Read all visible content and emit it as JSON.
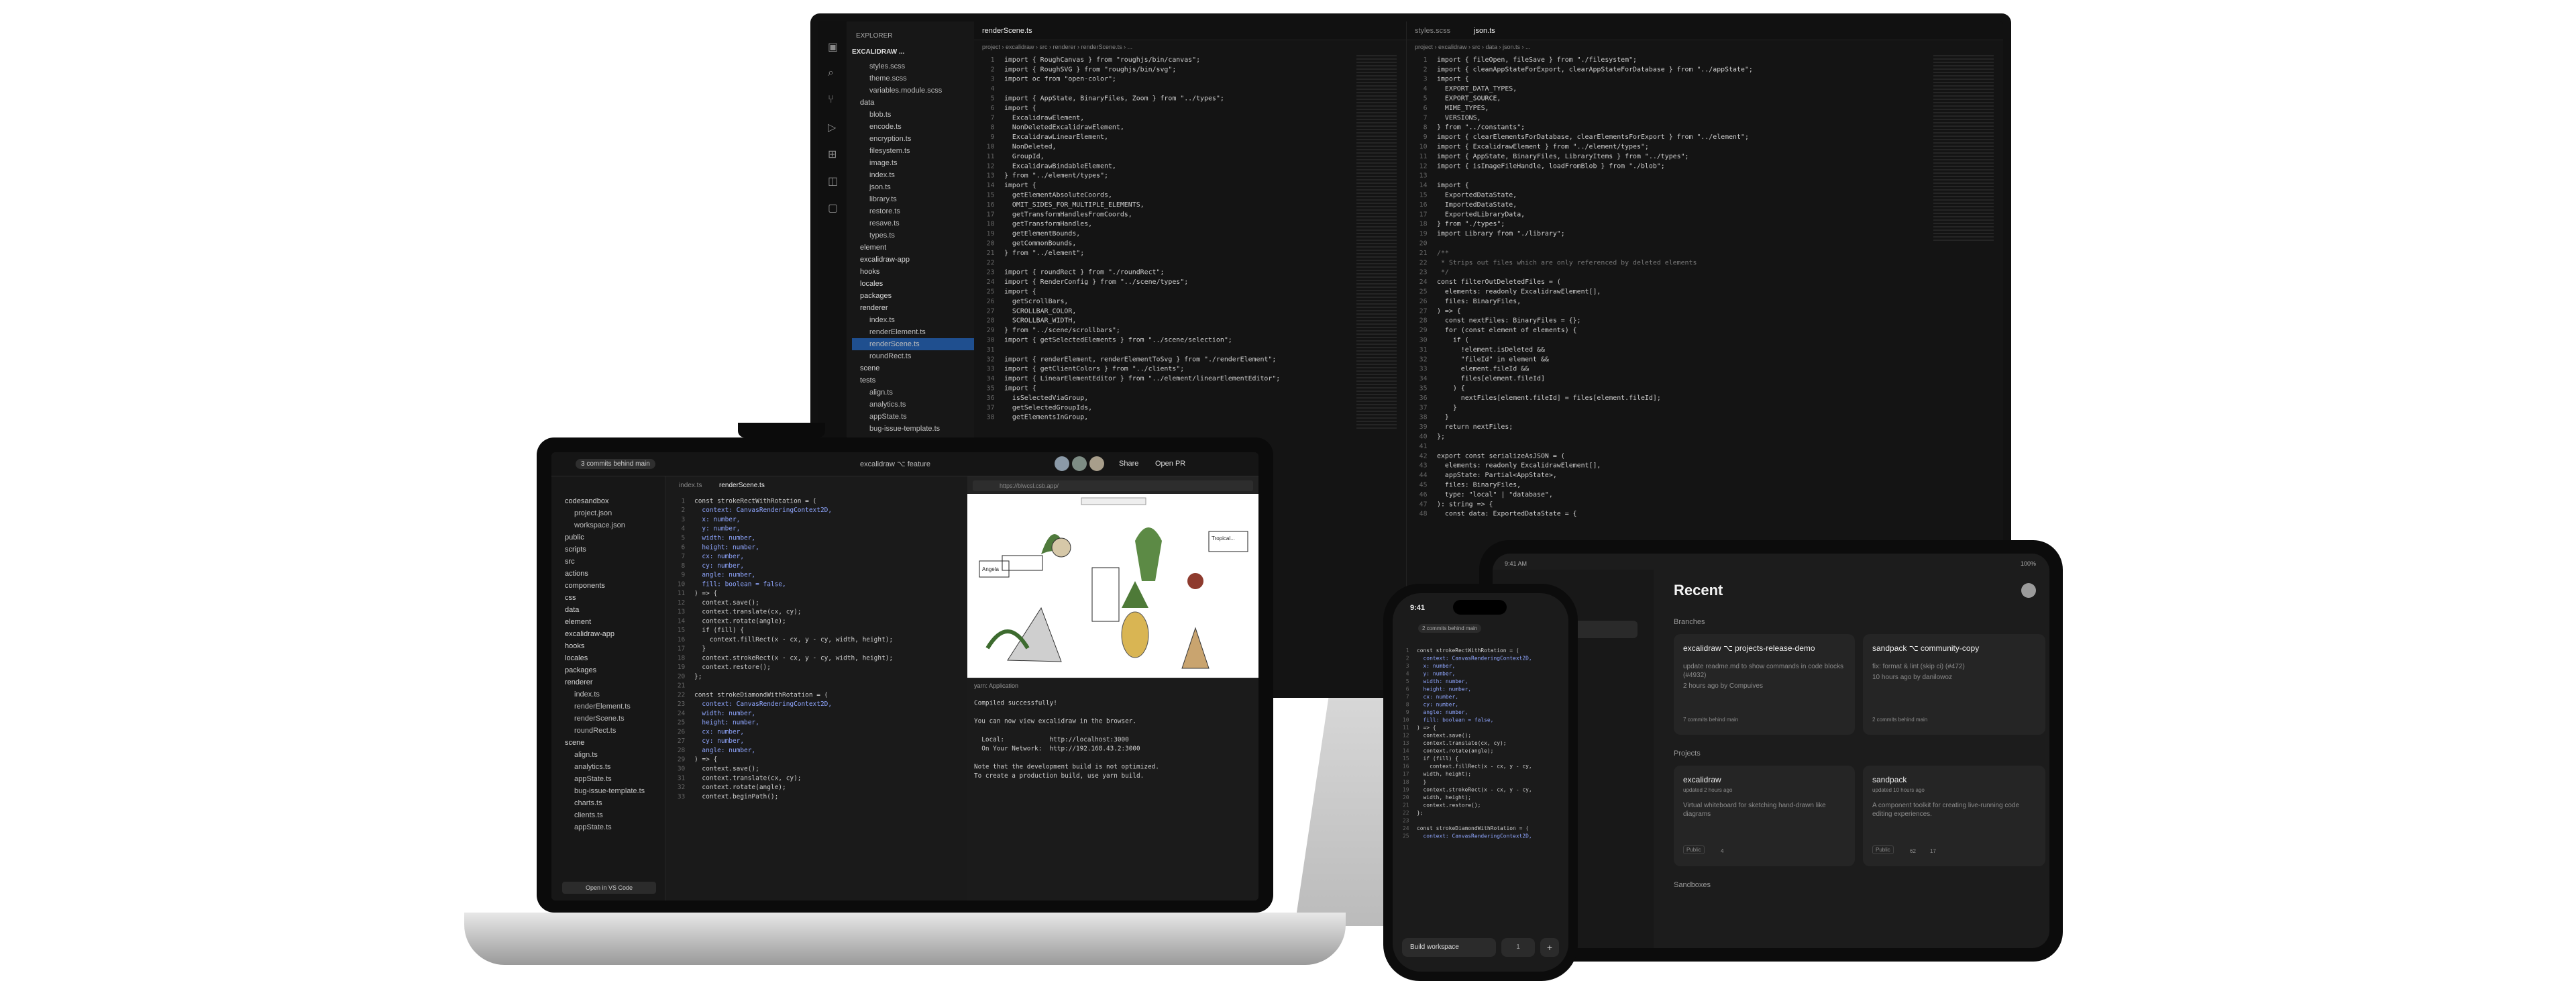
{
  "monitor": {
    "explorer_title": "EXPLORER",
    "project": "EXCALIDRAW ...",
    "tree": [
      "styles.scss",
      "theme.scss",
      "variables.module.scss",
      "data",
      "blob.ts",
      "encode.ts",
      "encryption.ts",
      "filesystem.ts",
      "image.ts",
      "index.ts",
      "json.ts",
      "library.ts",
      "restore.ts",
      "resave.ts",
      "types.ts",
      "element",
      "excalidraw-app",
      "hooks",
      "locales",
      "packages",
      "renderer",
      "index.ts",
      "renderElement.ts",
      "renderScene.ts",
      "roundRect.ts",
      "scene",
      "tests",
      "align.ts",
      "analytics.ts",
      "appState.ts",
      "bug-issue-template.ts"
    ],
    "tab_left": "renderScene.ts",
    "breadcrumb_left": "project › excalidraw › src › renderer › renderScene.ts › ...",
    "tab_right_1": "styles.scss",
    "tab_right_2": "json.ts",
    "breadcrumb_right": "project › excalidraw › src › data › json.ts › ...",
    "code_left": [
      "import { RoughCanvas } from \"roughjs/bin/canvas\";",
      "import { RoughSVG } from \"roughjs/bin/svg\";",
      "import oc from \"open-color\";",
      "",
      "import { AppState, BinaryFiles, Zoom } from \"../types\";",
      "import {",
      "  ExcalidrawElement,",
      "  NonDeletedExcalidrawElement,",
      "  ExcalidrawLinearElement,",
      "  NonDeleted,",
      "  GroupId,",
      "  ExcalidrawBindableElement,",
      "} from \"../element/types\";",
      "import {",
      "  getElementAbsoluteCoords,",
      "  OMIT_SIDES_FOR_MULTIPLE_ELEMENTS,",
      "  getTransformHandlesFromCoords,",
      "  getTransformHandles,",
      "  getElementBounds,",
      "  getCommonBounds,",
      "} from \"../element\";",
      "",
      "import { roundRect } from \"./roundRect\";",
      "import { RenderConfig } from \"../scene/types\";",
      "import {",
      "  getScrollBars,",
      "  SCROLLBAR_COLOR,",
      "  SCROLLBAR_WIDTH,",
      "} from \"../scene/scrollbars\";",
      "import { getSelectedElements } from \"../scene/selection\";",
      "",
      "import { renderElement, renderElementToSvg } from \"./renderElement\";",
      "import { getClientColors } from \"../clients\";",
      "import { LinearElementEditor } from \"../element/linearElementEditor\";",
      "import {",
      "  isSelectedViaGroup,",
      "  getSelectedGroupIds,",
      "  getElementsInGroup,"
    ],
    "code_right": [
      "import { fileOpen, fileSave } from \"./filesystem\";",
      "import { cleanAppStateForExport, clearAppStateForDatabase } from \"../appState\";",
      "import {",
      "  EXPORT_DATA_TYPES,",
      "  EXPORT_SOURCE,",
      "  MIME_TYPES,",
      "  VERSIONS,",
      "} from \"../constants\";",
      "import { clearElementsForDatabase, clearElementsForExport } from \"../element\";",
      "import { ExcalidrawElement } from \"../element/types\";",
      "import { AppState, BinaryFiles, LibraryItems } from \"../types\";",
      "import { isImageFileHandle, loadFromBlob } from \"./blob\";",
      "",
      "import {",
      "  ExportedDataState,",
      "  ImportedDataState,",
      "  ExportedLibraryData,",
      "} from \"./types\";",
      "import Library from \"./library\";",
      "",
      "/**",
      " * Strips out files which are only referenced by deleted elements",
      " */",
      "const filterOutDeletedFiles = (",
      "  elements: readonly ExcalidrawElement[],",
      "  files: BinaryFiles,",
      ") => {",
      "  const nextFiles: BinaryFiles = {};",
      "  for (const element of elements) {",
      "    if (",
      "      !element.isDeleted &&",
      "      \"fileId\" in element &&",
      "      element.fileId &&",
      "      files[element.fileId]",
      "    ) {",
      "      nextFiles[element.fileId] = files[element.fileId];",
      "    }",
      "  }",
      "  return nextFiles;",
      "};",
      "",
      "export const serializeAsJSON = (",
      "  elements: readonly ExcalidrawElement[],",
      "  appState: Partial<AppState>,",
      "  files: BinaryFiles,",
      "  type: \"local\" | \"database\",",
      "): string => {",
      "  const data: ExportedDataState = {"
    ]
  },
  "laptop": {
    "branch_badge": "3 commits behind main",
    "title_center": "excalidraw ⌥ feature",
    "share": "Share",
    "open_pr": "Open PR",
    "tree": [
      "codesandbox",
      "project.json",
      "workspace.json",
      "public",
      "scripts",
      "src",
      "actions",
      "components",
      "css",
      "data",
      "element",
      "excalidraw-app",
      "hooks",
      "locales",
      "packages",
      "renderer",
      "index.ts",
      "renderElement.ts",
      "renderScene.ts",
      "roundRect.ts",
      "scene",
      "align.ts",
      "analytics.ts",
      "appState.ts",
      "bug-issue-template.ts",
      "charts.ts",
      "clients.ts",
      "appState.ts"
    ],
    "open_vscode": "Open in VS Code",
    "tab1": "index.ts",
    "tab2": "renderScene.ts",
    "code": [
      "const strokeRectWithRotation = (",
      "  context: CanvasRenderingContext2D,",
      "  x: number,",
      "  y: number,",
      "  width: number,",
      "  height: number,",
      "  cx: number,",
      "  cy: number,",
      "  angle: number,",
      "  fill: boolean = false,",
      ") => {",
      "  context.save();",
      "  context.translate(cx, cy);",
      "  context.rotate(angle);",
      "  if (fill) {",
      "    context.fillRect(x - cx, y - cy, width, height);",
      "  }",
      "  context.strokeRect(x - cx, y - cy, width, height);",
      "  context.restore();",
      "};",
      "",
      "const strokeDiamondWithRotation = (",
      "  context: CanvasRenderingContext2D,",
      "  width: number,",
      "  height: number,",
      "  cx: number,",
      "  cy: number,",
      "  angle: number,",
      ") => {",
      "  context.save();",
      "  context.translate(cx, cy);",
      "  context.rotate(angle);",
      "  context.beginPath();"
    ],
    "url": "https://blwcsl.csb.app/",
    "terminal_tab": "yarn: Application",
    "terminal": [
      "Compiled successfully!",
      "",
      "You can now view excalidraw in the browser.",
      "",
      "  Local:            http://localhost:3000",
      "  On Your Network:  http://192.168.43.2:3000",
      "",
      "Note that the development build is not optimized.",
      "To create a production build, use yarn build."
    ],
    "canvas_label_1": "Angela",
    "canvas_label_2": "Tropical..."
  },
  "tablet": {
    "status_time": "9:41 AM",
    "status_right": "100%",
    "heading": "Recent",
    "section_branches": "Branches",
    "section_projects": "Projects",
    "section_sandboxes": "Sandboxes",
    "cards": [
      {
        "title": "excalidraw ⌥ projects-release-demo",
        "desc": "update readme.md to show commands in code blocks (#4932)",
        "meta": "2 hours ago by Compuives",
        "foot": "7 commits behind main"
      },
      {
        "title": "sandpack ⌥ community-copy",
        "desc": "fix: format & lint (skip ci) (#472)",
        "meta": "10 hours ago by danilowoz",
        "foot": "2 commits behind main"
      },
      {
        "title": "excalidraw",
        "desc": "Virtual whiteboard for sketching hand-drawn like diagrams",
        "meta": "updated 2 hours ago",
        "foot": "Public"
      },
      {
        "title": "sandpack",
        "desc": "A component toolkit for creating live-running code editing experiences.",
        "meta": "updated 10 hours ago",
        "foot": "Public"
      }
    ],
    "stats": [
      "4",
      "62",
      "17"
    ]
  },
  "phone": {
    "time": "9:41",
    "badge": "2 commits behind main",
    "code": [
      "const strokeRectWithRotation = (",
      "  context: CanvasRenderingContext2D,",
      "  x: number,",
      "  y: number,",
      "  width: number,",
      "  height: number,",
      "  cx: number,",
      "  cy: number,",
      "  angle: number,",
      "  fill: boolean = false,",
      ") => {",
      "  context.save();",
      "  context.translate(cx, cy);",
      "  context.rotate(angle);",
      "  if (fill) {",
      "    context.fillRect(x - cx, y - cy,",
      "  width, height);",
      "  }",
      "  context.strokeRect(x - cx, y - cy,",
      "  width, height);",
      "  context.restore();",
      "};",
      "",
      "const strokeDiamondWithRotation = (",
      "  context: CanvasRenderingContext2D,"
    ],
    "build_button": "Build workspace",
    "page_counter": "1"
  }
}
